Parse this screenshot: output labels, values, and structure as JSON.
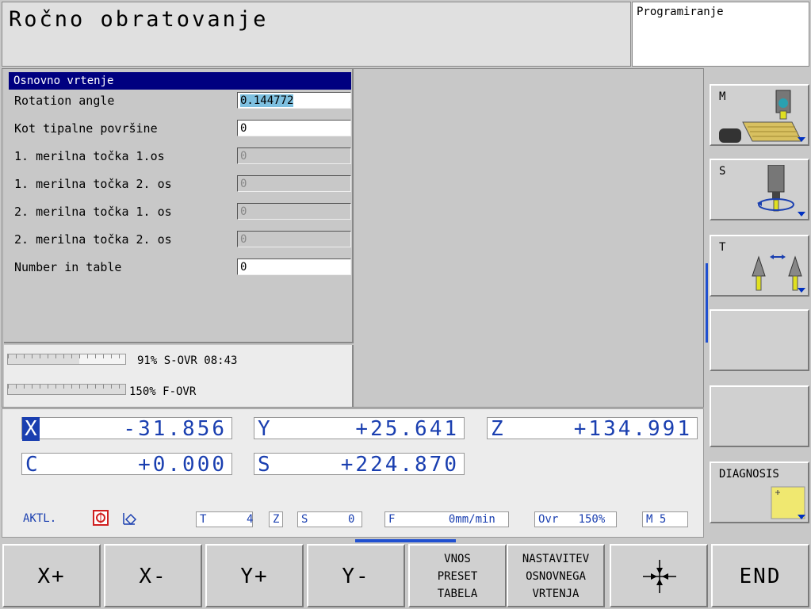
{
  "header": {
    "title": "Ročno obratovanje",
    "mode": "Programiranje"
  },
  "form": {
    "title": "Osnovno vrtenje",
    "rows": [
      {
        "label": "Rotation angle",
        "value": "0.144772",
        "state": "selected"
      },
      {
        "label": "Kot tipalne površine",
        "value": "0",
        "state": "active"
      },
      {
        "label": "1. merilna točka 1.os",
        "value": "0",
        "state": "disabled"
      },
      {
        "label": "1. merilna točka 2. os",
        "value": "0",
        "state": "disabled"
      },
      {
        "label": "2. merilna točka 1. os",
        "value": "0",
        "state": "disabled"
      },
      {
        "label": "2. merilna točka 2. os",
        "value": "0",
        "state": "disabled"
      },
      {
        "label": "Number in table",
        "value": "0",
        "state": "active"
      }
    ]
  },
  "override": {
    "s_text": "91% S-OVR 08:43",
    "s_level": 0.91,
    "f_text": "150% F-OVR",
    "f_level": 1.0
  },
  "position": {
    "axes": [
      {
        "axis": "X",
        "value": "-31.856",
        "selected": true
      },
      {
        "axis": "Y",
        "value": "+25.641",
        "selected": false
      },
      {
        "axis": "Z",
        "value": "+134.991",
        "selected": false
      },
      {
        "axis": "C",
        "value": "+0.000",
        "selected": false
      },
      {
        "axis": "S",
        "value": "+224.870",
        "selected": false
      }
    ],
    "mode_label": "AKTL.",
    "status": {
      "t": "T      4",
      "z": "Z",
      "s": "S      0",
      "f": "F        0mm/min",
      "ovr": "Ovr   150%",
      "m": "M 5"
    }
  },
  "right_softkeys": [
    {
      "label": "M",
      "icon": "machine-table-icon"
    },
    {
      "label": "S",
      "icon": "spindle-icon"
    },
    {
      "label": "T",
      "icon": "tool-change-icon"
    },
    {
      "label": "",
      "icon": ""
    },
    {
      "label": "",
      "icon": ""
    },
    {
      "label": "DIAGNOSIS",
      "icon": "diagnosis-icon"
    }
  ],
  "bottom_softkeys": [
    {
      "label": "X+"
    },
    {
      "label": "X-"
    },
    {
      "label": "Y+"
    },
    {
      "label": "Y-"
    },
    {
      "label": "VNOS\nPRESET\nTABELA"
    },
    {
      "label": "NASTAVITEV\nOSNOVNEGA\nVRTENJA"
    },
    {
      "label": "",
      "icon": "crosshair-icon"
    },
    {
      "label": "END"
    }
  ],
  "colors": {
    "accent": "#1a3fb0",
    "title_bar": "#000080",
    "selection": "#7ec0e0"
  }
}
